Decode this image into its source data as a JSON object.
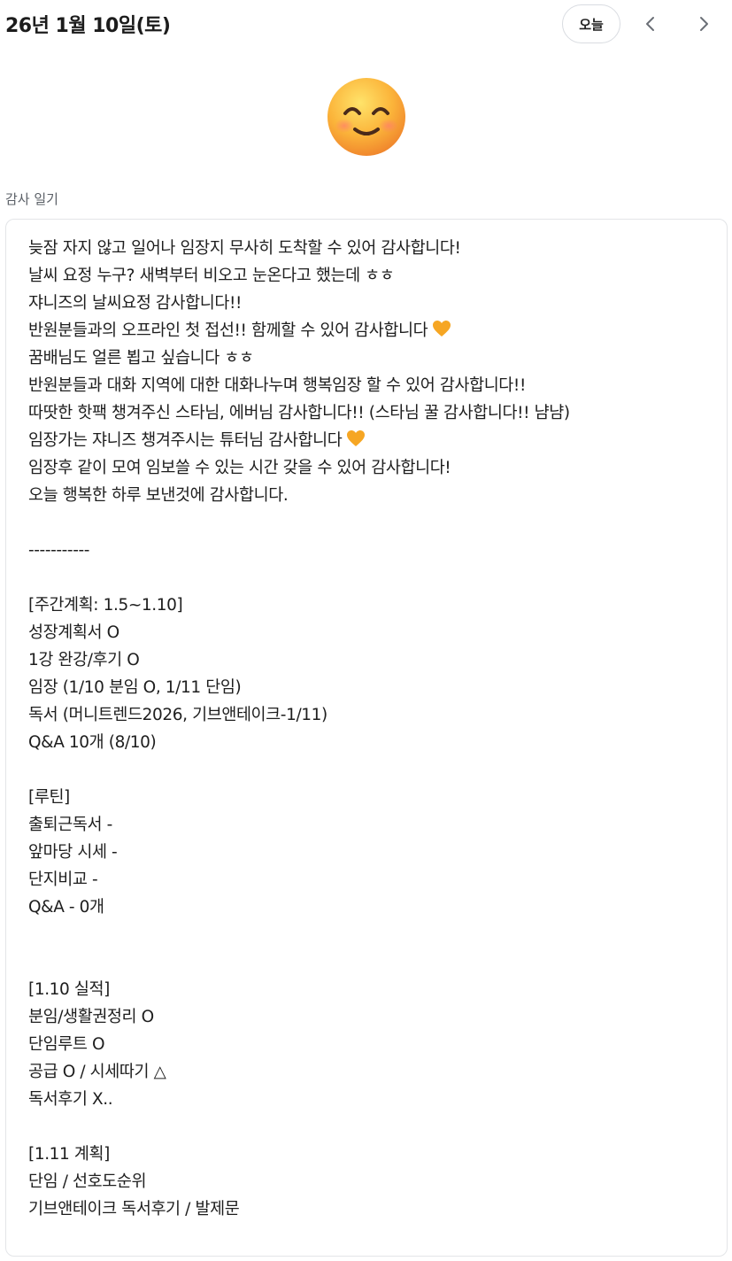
{
  "header": {
    "date_title": "26년 1월 10일(토)",
    "today_label": "오늘",
    "prev_icon": "chevron-left-icon",
    "next_icon": "chevron-right-icon"
  },
  "mood": {
    "icon": "smiling-face-emoji"
  },
  "section_label": "감사 일기",
  "entry": {
    "lines": [
      {
        "text": "늦잠 자지 않고 일어나 임장지 무사히 도착할 수 있어 감사합니다!",
        "heart": false
      },
      {
        "text": "날씨 요정 누구? 새벽부터 비오고 눈온다고 했는데 ㅎㅎ",
        "heart": false
      },
      {
        "text": "쟈니즈의 날씨요정 감사합니다!!",
        "heart": false
      },
      {
        "text": "반원분들과의 오프라인 첫 접선!! 함께할 수 있어 감사합니다",
        "heart": true
      },
      {
        "text": "꿈배님도 얼른 뵙고 싶습니다 ㅎㅎ",
        "heart": false
      },
      {
        "text": "반원분들과 대화 지역에 대한 대화나누며 행복임장 할 수 있어 감사합니다!!",
        "heart": false
      },
      {
        "text": "따땃한 핫팩 챙겨주신 스타님, 에버님 감사합니다!! (스타님 꿀 감사합니다!! 냠냠)",
        "heart": false
      },
      {
        "text": "임장가는 쟈니즈 챙겨주시는 튜터님 감사합니다",
        "heart": true
      },
      {
        "text": "임장후 같이 모여 임보쓸 수 있는 시간 갖을 수 있어 감사합니다!",
        "heart": false
      },
      {
        "text": "오늘 행복한 하루 보낸것에 감사합니다.",
        "heart": false
      },
      {
        "text": "",
        "heart": false
      },
      {
        "text": "-----------",
        "heart": false
      },
      {
        "text": "",
        "heart": false
      },
      {
        "text": "[주간계획: 1.5~1.10]",
        "heart": false
      },
      {
        "text": "성장계획서 O",
        "heart": false
      },
      {
        "text": "1강 완강/후기 O",
        "heart": false
      },
      {
        "text": "임장 (1/10 분임 O, 1/11 단임)",
        "heart": false
      },
      {
        "text": "독서 (머니트렌드2026, 기브앤테이크-1/11)",
        "heart": false
      },
      {
        "text": "Q&A 10개 (8/10)",
        "heart": false
      },
      {
        "text": "",
        "heart": false
      },
      {
        "text": "[루틴]",
        "heart": false
      },
      {
        "text": "출퇴근독서 -",
        "heart": false
      },
      {
        "text": "앞마당 시세 -",
        "heart": false
      },
      {
        "text": "단지비교 -",
        "heart": false
      },
      {
        "text": "Q&A - 0개",
        "heart": false
      },
      {
        "text": "",
        "heart": false
      },
      {
        "text": "",
        "heart": false
      },
      {
        "text": "[1.10 실적]",
        "heart": false
      },
      {
        "text": "분임/생활권정리 O",
        "heart": false
      },
      {
        "text": "단임루트 O",
        "heart": false
      },
      {
        "text": "공급 O / 시세따기 △",
        "heart": false
      },
      {
        "text": "독서후기 X..",
        "heart": false
      },
      {
        "text": "",
        "heart": false
      },
      {
        "text": "[1.11 계획]",
        "heart": false
      },
      {
        "text": "단임 / 선호도순위",
        "heart": false
      },
      {
        "text": "기브앤테이크 독서후기 / 발제문",
        "heart": false
      }
    ],
    "heart_icon": "orange-heart-icon",
    "heart_color": "#F6A623"
  }
}
